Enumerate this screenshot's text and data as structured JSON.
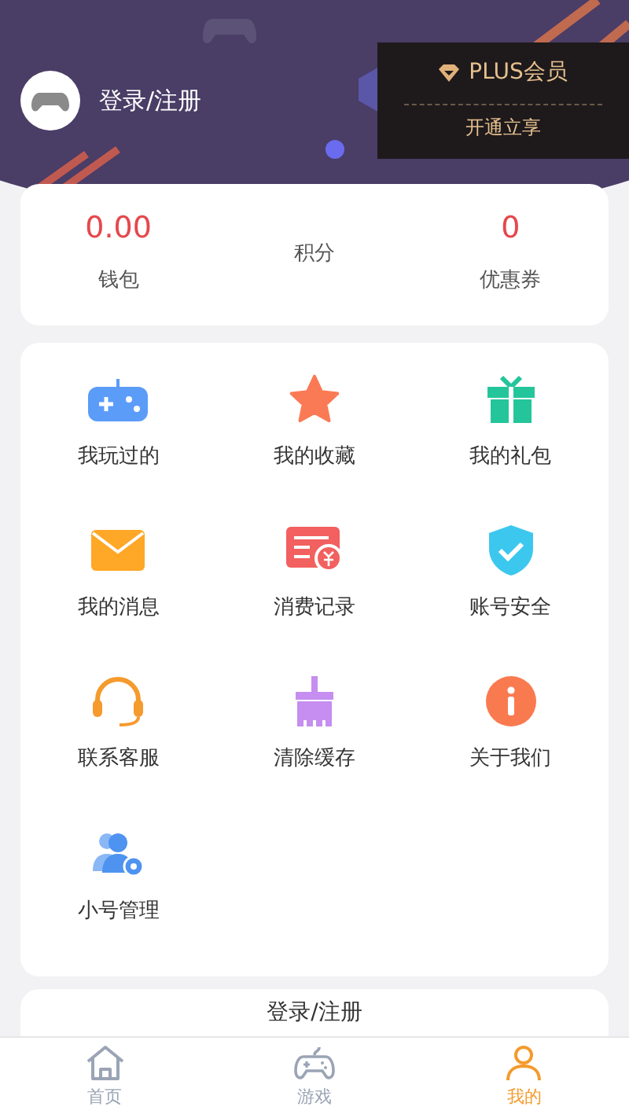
{
  "profile": {
    "login_text": "登录/注册"
  },
  "plus": {
    "title": "PLUS会员",
    "subtitle": "开通立享"
  },
  "stats": [
    {
      "value": "0.00",
      "label": "钱包"
    },
    {
      "label": "积分"
    },
    {
      "value": "0",
      "label": "优惠券"
    }
  ],
  "menu": [
    {
      "kind": "gamepad",
      "label": "我玩过的"
    },
    {
      "kind": "star",
      "label": "我的收藏"
    },
    {
      "kind": "gift",
      "label": "我的礼包"
    },
    {
      "kind": "mail",
      "label": "我的消息"
    },
    {
      "kind": "bill",
      "label": "消费记录"
    },
    {
      "kind": "shield",
      "label": "账号安全"
    },
    {
      "kind": "headset",
      "label": "联系客服"
    },
    {
      "kind": "broom",
      "label": "清除缓存"
    },
    {
      "kind": "info",
      "label": "关于我们"
    },
    {
      "kind": "users",
      "label": "小号管理"
    }
  ],
  "login_button": "登录/注册",
  "tabs": [
    {
      "kind": "home",
      "label": "首页",
      "selected": false
    },
    {
      "kind": "game",
      "label": "游戏",
      "selected": false
    },
    {
      "kind": "user",
      "label": "我的",
      "selected": true
    }
  ]
}
